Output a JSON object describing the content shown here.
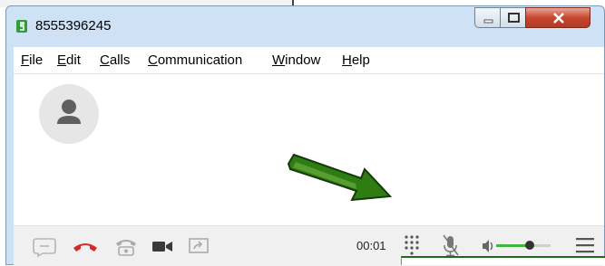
{
  "window": {
    "title": "8555396245"
  },
  "menu": {
    "items": [
      "File",
      "Edit",
      "Calls",
      "Communication",
      "Window",
      "Help"
    ]
  },
  "call": {
    "timer": "00:01",
    "volume_level": 0.62
  },
  "icons": {
    "app": "phone-app-icon",
    "avatar": "person-icon",
    "chat": "chat-icon",
    "hangup": "hangup-icon",
    "transfer": "transfer-icon",
    "video": "video-camera-icon",
    "screen_share": "screen-share-icon",
    "dialpad": "dialpad-icon",
    "mute": "microphone-mute-icon",
    "volume": "speaker-icon",
    "menu": "hamburger-menu-icon",
    "annotation": "green-arrow-annotation"
  },
  "colors": {
    "hangup": "#d42a2a",
    "volume_fill": "#3fb63f",
    "annotation_arrow": "#2f7d12"
  }
}
